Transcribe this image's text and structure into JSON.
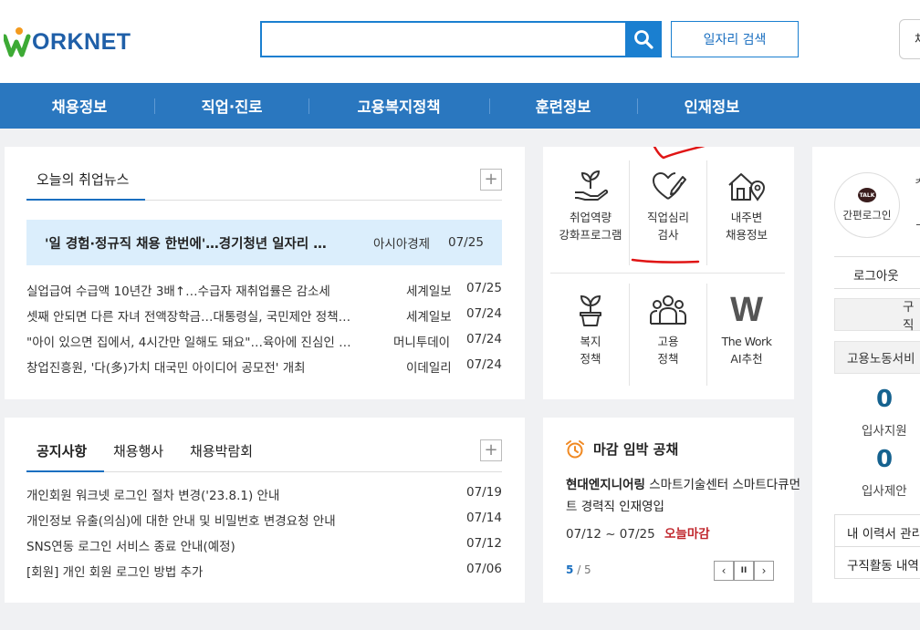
{
  "header": {
    "logo_text": "ORKNET",
    "search_placeholder": "",
    "job_search_label": "일자리 검색",
    "corner_label": "채"
  },
  "nav": {
    "items": [
      "채용정보",
      "직업·진로",
      "고용복지정책",
      "훈련정보",
      "인재정보"
    ]
  },
  "news": {
    "title": "오늘의 취업뉴스",
    "headline": {
      "title": "'일 경험·정규직 채용 한번에'…경기청년 일자리 …",
      "source": "아시아경제",
      "date": "07/25"
    },
    "items": [
      {
        "title": "실업급여 수급액 10년간 3배↑…수급자 재취업률은 감소세",
        "source": "세계일보",
        "date": "07/25"
      },
      {
        "title": "셋째 안되면 다른 자녀 전액장학금…대통령실, 국민제안 정책…",
        "source": "세계일보",
        "date": "07/24"
      },
      {
        "title": "\"아이 있으면 집에서, 4시간만 일해도 돼요\"…육아에 진심인 …",
        "source": "머니투데이",
        "date": "07/24"
      },
      {
        "title": "창업진흥원, '다(多)가치 대국민 아이디어 공모전' 개최",
        "source": "이데일리",
        "date": "07/24"
      }
    ]
  },
  "services": [
    {
      "line1": "취업역량",
      "line2": "강화프로그램",
      "icon": "sprout-hand-icon"
    },
    {
      "line1": "직업심리",
      "line2": "검사",
      "icon": "heart-pencil-icon"
    },
    {
      "line1": "내주변",
      "line2": "채용정보",
      "icon": "house-pin-icon"
    },
    {
      "line1": "복지",
      "line2": "정책",
      "icon": "plant-pot-icon"
    },
    {
      "line1": "고용",
      "line2": "정책",
      "icon": "people-group-icon"
    },
    {
      "line1": "The Work",
      "line2": "AI추천",
      "icon": "w-logo-icon",
      "glyph": "W"
    }
  ],
  "notice": {
    "tabs": [
      "공지사항",
      "채용행사",
      "채용박람회"
    ],
    "items": [
      {
        "title": "개인회원 워크넷 로그인 절차 변경('23.8.1) 안내",
        "date": "07/19"
      },
      {
        "title": "개인정보 유출(의심)에 대한 안내 및 비밀번호 변경요청 안내",
        "date": "07/14"
      },
      {
        "title": "SNS연동 로그인 서비스 종료 안내(예정)",
        "date": "07/12"
      },
      {
        "title": "[회원] 개인 회원 로그인 방법 추가",
        "date": "07/06"
      }
    ]
  },
  "deadline": {
    "title": "마감 임박 공채",
    "company_bold": "현대엔지니어링",
    "company_rest": "스마트기술센터 스마트다큐먼트 경력직 인재영입",
    "period": "07/12 ~ 07/25",
    "today_label": "오늘마감",
    "page_current": "5",
    "page_total": "/ 5",
    "prev": "‹",
    "pause": "II",
    "next": "›"
  },
  "side": {
    "talk_badge": "TALK",
    "easy_login": "간편로그인",
    "name_char_1": "ᄎ",
    "name_char_2": "ᄀ",
    "logout": "로그아웃",
    "box1": "구직",
    "box2": "고용노동서비",
    "count1": "0",
    "label1": "입사지원",
    "count2": "0",
    "label2": "입사제안",
    "link1": "내 이력서 관리",
    "link2": "구직활동 내역"
  },
  "colors": {
    "nav_bg": "#2a77bf",
    "accent": "#1a7fd0",
    "highlight_bg": "#dbeefc",
    "today_red": "#c0262c",
    "count_blue": "#15628f"
  }
}
